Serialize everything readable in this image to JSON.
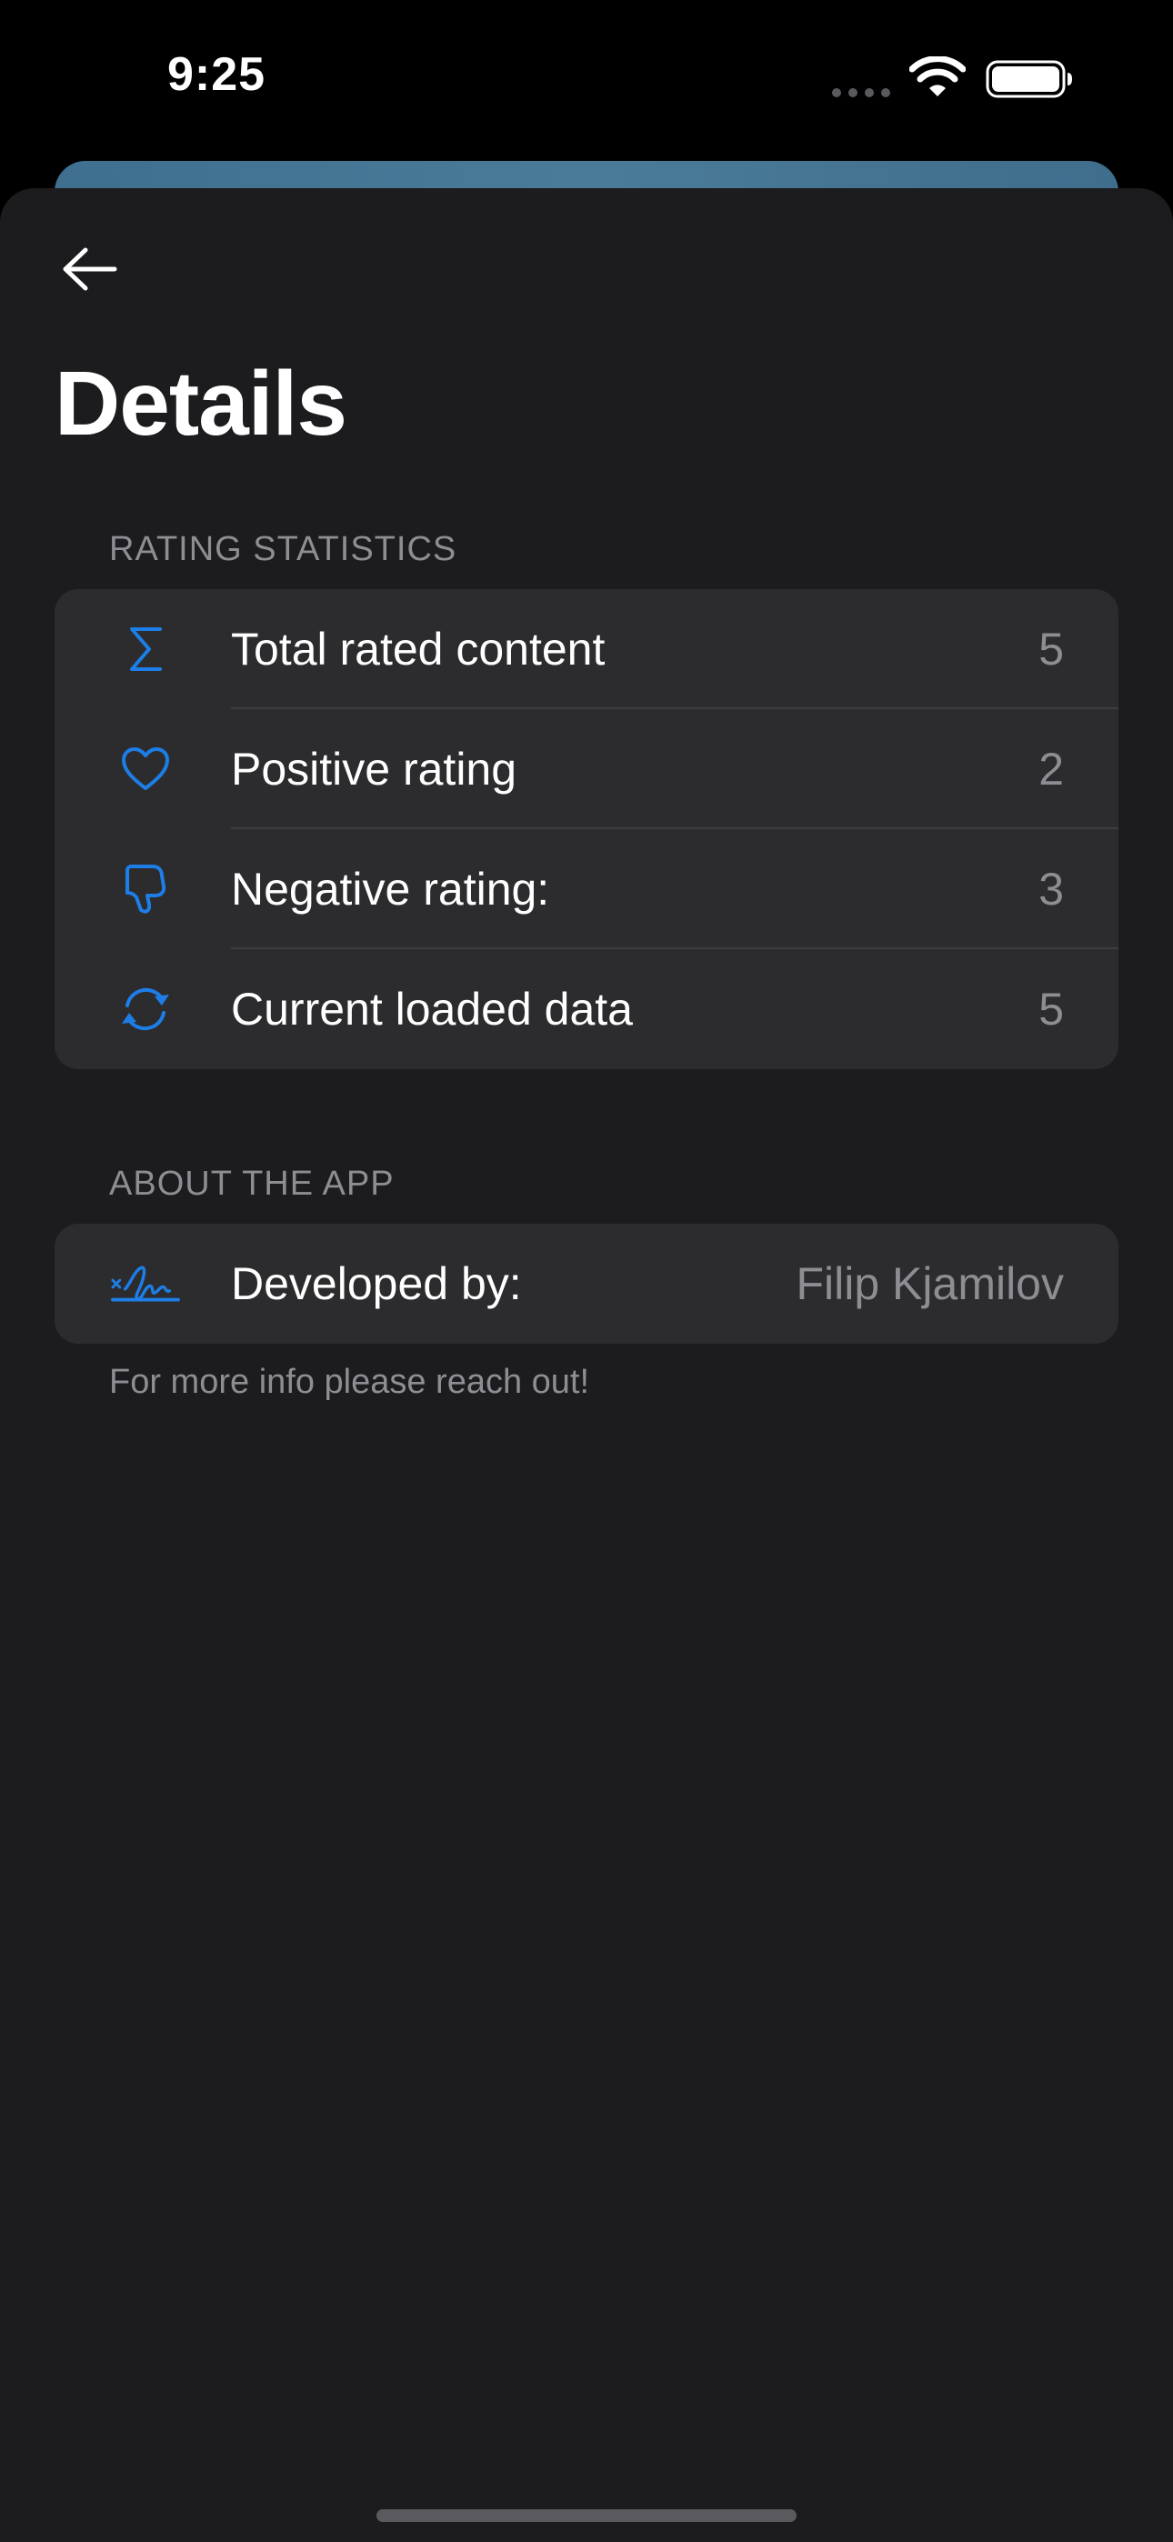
{
  "status_bar": {
    "time": "9:25"
  },
  "header": {
    "title": "Details"
  },
  "rating_statistics": {
    "header": "RATING STATISTICS",
    "rows": [
      {
        "icon": "sigma-icon",
        "label": "Total rated content",
        "value": "5"
      },
      {
        "icon": "heart-icon",
        "label": "Positive rating",
        "value": "2"
      },
      {
        "icon": "thumbs-down-icon",
        "label": "Negative rating:",
        "value": "3"
      },
      {
        "icon": "refresh-icon",
        "label": "Current loaded data",
        "value": "5"
      }
    ]
  },
  "about": {
    "header": "ABOUT THE APP",
    "rows": [
      {
        "icon": "signature-icon",
        "label": "Developed by:",
        "value": "Filip Kjamilov"
      }
    ],
    "footer": "For more info please reach out!"
  },
  "colors": {
    "accent": "#1c7ee6",
    "sheet_background": "#1c1c1e",
    "group_background": "#2c2c2e",
    "secondary_text": "#8d8d93"
  }
}
